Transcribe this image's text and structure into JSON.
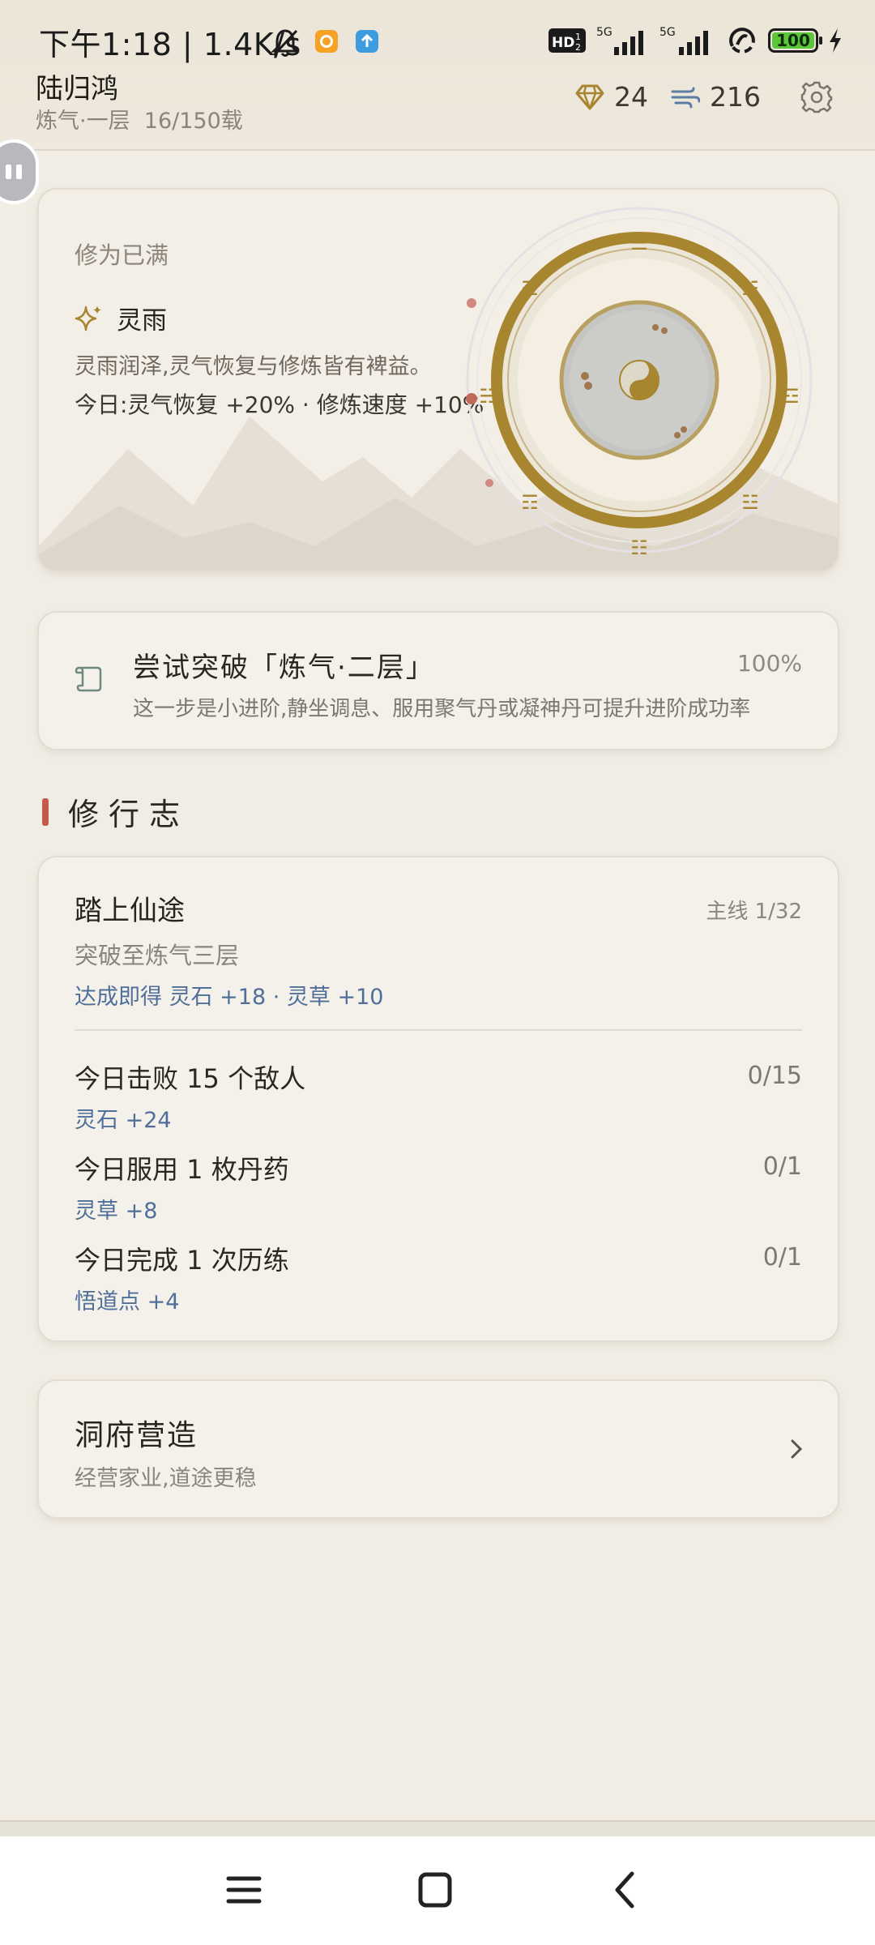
{
  "status_bar": {
    "time": "下午1:18",
    "net_speed": "1.4K/s",
    "battery": "100",
    "network_labels": [
      "5G",
      "5G"
    ]
  },
  "player": {
    "name": "陆归鸿",
    "realm": "炼气·一层",
    "lifespan": "16/150载",
    "spirit_stones": "24",
    "qi": "216"
  },
  "cultivation": {
    "status": "修为已满",
    "weather_name": "灵雨",
    "weather_desc": "灵雨润泽,灵气恢复与修炼皆有裨益。",
    "today_effect": "今日:灵气恢复 +20% · 修炼速度 +10%",
    "trigrams": [
      "☰",
      "☱",
      "☲",
      "☳",
      "☷",
      "☶",
      "☵",
      "☴"
    ]
  },
  "breakthrough": {
    "title": "尝试突破「炼气·二层」",
    "percent": "100%",
    "desc": "这一步是小进阶,静坐调息、服用聚气丹或凝神丹可提升进阶成功率"
  },
  "journal": {
    "section_title": "修行志",
    "main_quest": {
      "title": "踏上仙途",
      "tag": "主线 1/32",
      "subtitle": "突破至炼气三层",
      "reward": "达成即得 灵石 +18 · 灵草 +10"
    },
    "daily": [
      {
        "name": "今日击败 15 个敌人",
        "progress": "0/15",
        "reward": "灵石 +24"
      },
      {
        "name": "今日服用 1 枚丹药",
        "progress": "0/1",
        "reward": "灵草 +8"
      },
      {
        "name": "今日完成 1 次历练",
        "progress": "0/1",
        "reward": "悟道点 +4"
      }
    ]
  },
  "cave": {
    "title": "洞府营造",
    "subtitle": "经营家业,道途更稳"
  },
  "colors": {
    "accent_gold": "#a8852f",
    "accent_red": "#c45a4e",
    "reward_blue": "#4f6f9a",
    "background": "#f1ede5"
  },
  "icons": {
    "status": [
      "silent-bell-icon",
      "orange-app-icon",
      "blue-upload-icon",
      "hd-icon",
      "signal-icon",
      "hotspot-icon",
      "charging-icon"
    ],
    "resources": [
      "diamond-icon",
      "wind-icon",
      "gear-icon"
    ],
    "nav": [
      "menu-icon",
      "home-icon",
      "back-icon"
    ]
  }
}
